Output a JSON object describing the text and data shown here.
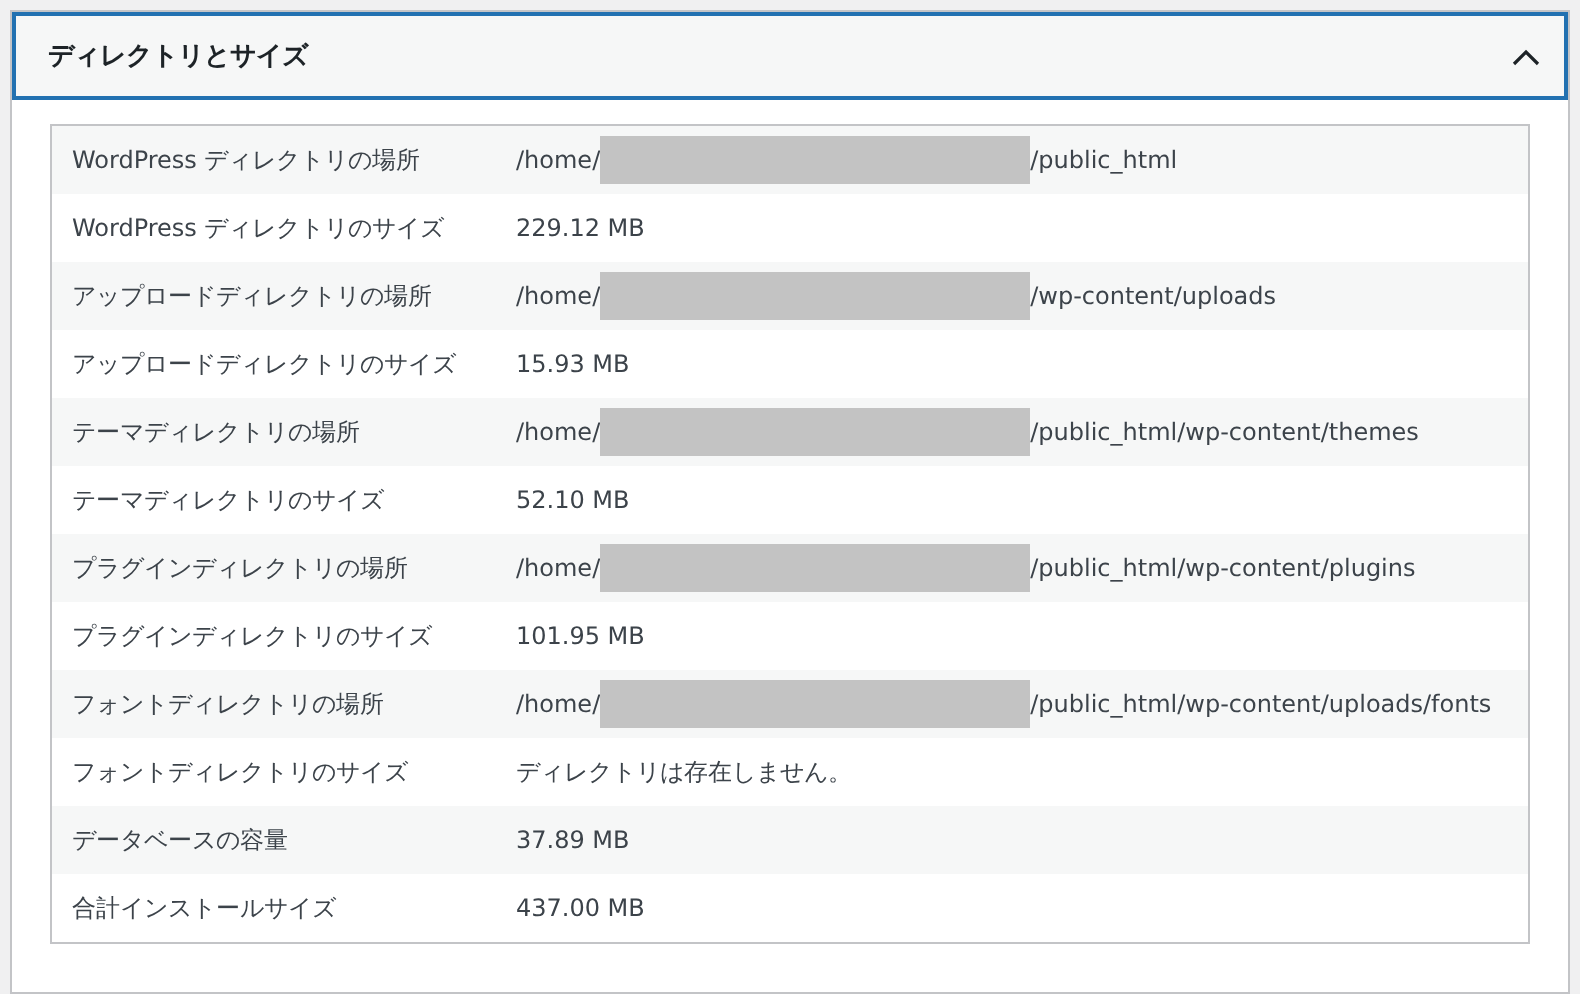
{
  "section": {
    "title": "ディレクトリとサイズ",
    "expanded": true
  },
  "rows": [
    {
      "label": "WordPress ディレクトリの場所",
      "value": [
        {
          "kind": "text",
          "text": "/home/"
        },
        {
          "kind": "redaction"
        },
        {
          "kind": "text",
          "text": "/public_html"
        }
      ]
    },
    {
      "label": "WordPress ディレクトリのサイズ",
      "value": [
        {
          "kind": "text",
          "text": "229.12 MB"
        }
      ]
    },
    {
      "label": "アップロードディレクトリの場所",
      "value": [
        {
          "kind": "text",
          "text": "/home/"
        },
        {
          "kind": "redaction"
        },
        {
          "kind": "text",
          "text": "/wp-content/uploads"
        }
      ]
    },
    {
      "label": "アップロードディレクトリのサイズ",
      "value": [
        {
          "kind": "text",
          "text": "15.93 MB"
        }
      ]
    },
    {
      "label": "テーマディレクトリの場所",
      "value": [
        {
          "kind": "text",
          "text": "/home/"
        },
        {
          "kind": "redaction"
        },
        {
          "kind": "text",
          "text": "/public_html/wp-content/themes"
        }
      ]
    },
    {
      "label": "テーマディレクトリのサイズ",
      "value": [
        {
          "kind": "text",
          "text": "52.10 MB"
        }
      ]
    },
    {
      "label": "プラグインディレクトリの場所",
      "value": [
        {
          "kind": "text",
          "text": "/home/"
        },
        {
          "kind": "redaction"
        },
        {
          "kind": "text",
          "text": "/public_html/wp-content/plugins"
        }
      ]
    },
    {
      "label": "プラグインディレクトリのサイズ",
      "value": [
        {
          "kind": "text",
          "text": "101.95 MB"
        }
      ]
    },
    {
      "label": "フォントディレクトリの場所",
      "value": [
        {
          "kind": "text",
          "text": "/home/"
        },
        {
          "kind": "redaction"
        },
        {
          "kind": "text",
          "text": "/public_html/wp-content/uploads/fonts"
        }
      ]
    },
    {
      "label": "フォントディレクトリのサイズ",
      "value": [
        {
          "kind": "text",
          "text": "ディレクトリは存在しません。"
        }
      ]
    },
    {
      "label": "データベースの容量",
      "value": [
        {
          "kind": "text",
          "text": "37.89 MB"
        }
      ]
    },
    {
      "label": "合計インストールサイズ",
      "value": [
        {
          "kind": "text",
          "text": "437.00 MB"
        }
      ]
    }
  ]
}
